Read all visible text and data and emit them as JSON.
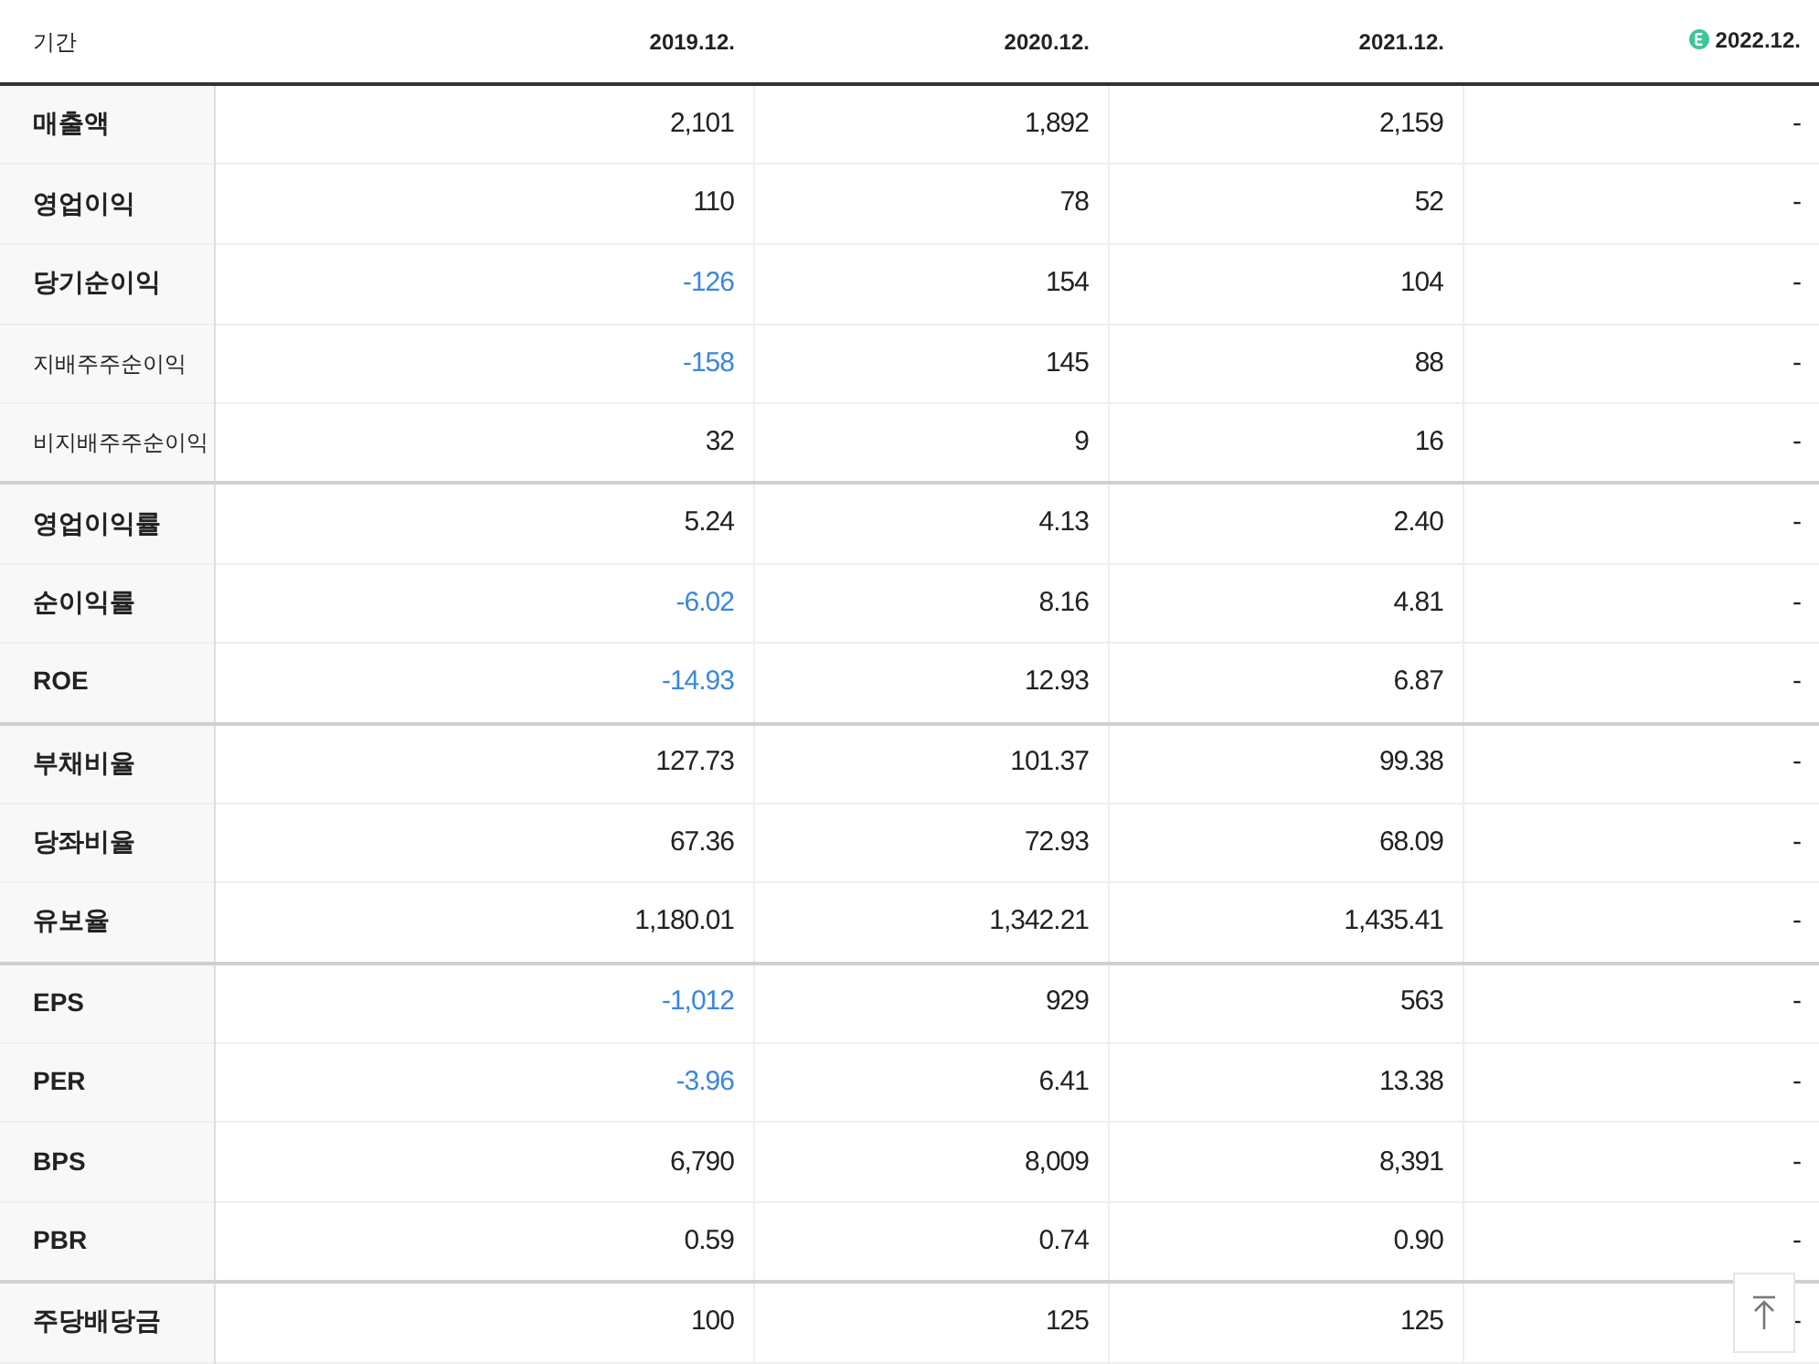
{
  "table": {
    "columns": [
      {
        "label": "기간",
        "estimate": false
      },
      {
        "label": "2019.12.",
        "estimate": false
      },
      {
        "label": "2020.12.",
        "estimate": false
      },
      {
        "label": "2021.12.",
        "estimate": false
      },
      {
        "label": "2022.12.",
        "estimate": true
      }
    ],
    "groups": [
      {
        "rows": [
          {
            "label": "매출액",
            "kind": "main",
            "cells": [
              {
                "text": "2,101",
                "negative": false
              },
              {
                "text": "1,892",
                "negative": false
              },
              {
                "text": "2,159",
                "negative": false
              },
              {
                "text": "-",
                "negative": false
              }
            ]
          },
          {
            "label": "영업이익",
            "kind": "main",
            "cells": [
              {
                "text": "110",
                "negative": false
              },
              {
                "text": "78",
                "negative": false
              },
              {
                "text": "52",
                "negative": false
              },
              {
                "text": "-",
                "negative": false
              }
            ]
          },
          {
            "label": "당기순이익",
            "kind": "main",
            "cells": [
              {
                "text": "-126",
                "negative": true
              },
              {
                "text": "154",
                "negative": false
              },
              {
                "text": "104",
                "negative": false
              },
              {
                "text": "-",
                "negative": false
              }
            ]
          },
          {
            "label": "지배주주순이익",
            "kind": "sub",
            "cells": [
              {
                "text": "-158",
                "negative": true
              },
              {
                "text": "145",
                "negative": false
              },
              {
                "text": "88",
                "negative": false
              },
              {
                "text": "-",
                "negative": false
              }
            ]
          },
          {
            "label": "비지배주주순이익",
            "kind": "sub",
            "cells": [
              {
                "text": "32",
                "negative": false
              },
              {
                "text": "9",
                "negative": false
              },
              {
                "text": "16",
                "negative": false
              },
              {
                "text": "-",
                "negative": false
              }
            ]
          }
        ]
      },
      {
        "rows": [
          {
            "label": "영업이익률",
            "kind": "main",
            "cells": [
              {
                "text": "5.24",
                "negative": false
              },
              {
                "text": "4.13",
                "negative": false
              },
              {
                "text": "2.40",
                "negative": false
              },
              {
                "text": "-",
                "negative": false
              }
            ]
          },
          {
            "label": "순이익률",
            "kind": "main",
            "cells": [
              {
                "text": "-6.02",
                "negative": true
              },
              {
                "text": "8.16",
                "negative": false
              },
              {
                "text": "4.81",
                "negative": false
              },
              {
                "text": "-",
                "negative": false
              }
            ]
          },
          {
            "label": "ROE",
            "kind": "main",
            "cells": [
              {
                "text": "-14.93",
                "negative": true
              },
              {
                "text": "12.93",
                "negative": false
              },
              {
                "text": "6.87",
                "negative": false
              },
              {
                "text": "-",
                "negative": false
              }
            ]
          }
        ]
      },
      {
        "rows": [
          {
            "label": "부채비율",
            "kind": "main",
            "cells": [
              {
                "text": "127.73",
                "negative": false
              },
              {
                "text": "101.37",
                "negative": false
              },
              {
                "text": "99.38",
                "negative": false
              },
              {
                "text": "-",
                "negative": false
              }
            ]
          },
          {
            "label": "당좌비율",
            "kind": "main",
            "cells": [
              {
                "text": "67.36",
                "negative": false
              },
              {
                "text": "72.93",
                "negative": false
              },
              {
                "text": "68.09",
                "negative": false
              },
              {
                "text": "-",
                "negative": false
              }
            ]
          },
          {
            "label": "유보율",
            "kind": "main",
            "cells": [
              {
                "text": "1,180.01",
                "negative": false
              },
              {
                "text": "1,342.21",
                "negative": false
              },
              {
                "text": "1,435.41",
                "negative": false
              },
              {
                "text": "-",
                "negative": false
              }
            ]
          }
        ]
      },
      {
        "rows": [
          {
            "label": "EPS",
            "kind": "main",
            "cells": [
              {
                "text": "-1,012",
                "negative": true
              },
              {
                "text": "929",
                "negative": false
              },
              {
                "text": "563",
                "negative": false
              },
              {
                "text": "-",
                "negative": false
              }
            ]
          },
          {
            "label": "PER",
            "kind": "main",
            "cells": [
              {
                "text": "-3.96",
                "negative": true
              },
              {
                "text": "6.41",
                "negative": false
              },
              {
                "text": "13.38",
                "negative": false
              },
              {
                "text": "-",
                "negative": false
              }
            ]
          },
          {
            "label": "BPS",
            "kind": "main",
            "cells": [
              {
                "text": "6,790",
                "negative": false
              },
              {
                "text": "8,009",
                "negative": false
              },
              {
                "text": "8,391",
                "negative": false
              },
              {
                "text": "-",
                "negative": false
              }
            ]
          },
          {
            "label": "PBR",
            "kind": "main",
            "cells": [
              {
                "text": "0.59",
                "negative": false
              },
              {
                "text": "0.74",
                "negative": false
              },
              {
                "text": "0.90",
                "negative": false
              },
              {
                "text": "-",
                "negative": false
              }
            ]
          }
        ]
      },
      {
        "rows": [
          {
            "label": "주당배당금",
            "kind": "main",
            "cells": [
              {
                "text": "100",
                "negative": false
              },
              {
                "text": "125",
                "negative": false
              },
              {
                "text": "125",
                "negative": false
              },
              {
                "text": "-",
                "negative": false
              }
            ]
          }
        ]
      }
    ]
  }
}
